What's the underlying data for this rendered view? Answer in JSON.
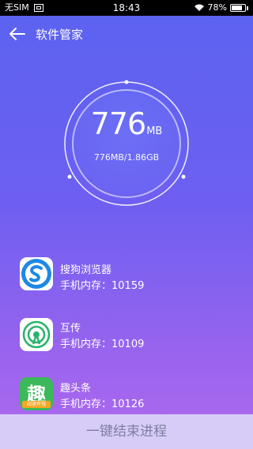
{
  "status_bar": {
    "carrier": "无SIM",
    "time": "18:43",
    "battery": "78%"
  },
  "header": {
    "title": "软件管家"
  },
  "memory": {
    "value": "776",
    "unit": "MB",
    "detail": "776MB/1.86GB"
  },
  "apps": [
    {
      "name": "搜狗浏览器",
      "memory": "手机内存：10159",
      "icon": "sogou-browser-icon"
    },
    {
      "name": "互传",
      "memory": "手机内存：10109",
      "icon": "easyshare-icon"
    },
    {
      "name": "趣头条",
      "memory": "手机内存：10126",
      "icon": "qutoutiao-icon",
      "icon_text": "趣",
      "icon_badge": "阅读有钱"
    }
  ],
  "footer": {
    "button_label": "一键结束进程"
  }
}
